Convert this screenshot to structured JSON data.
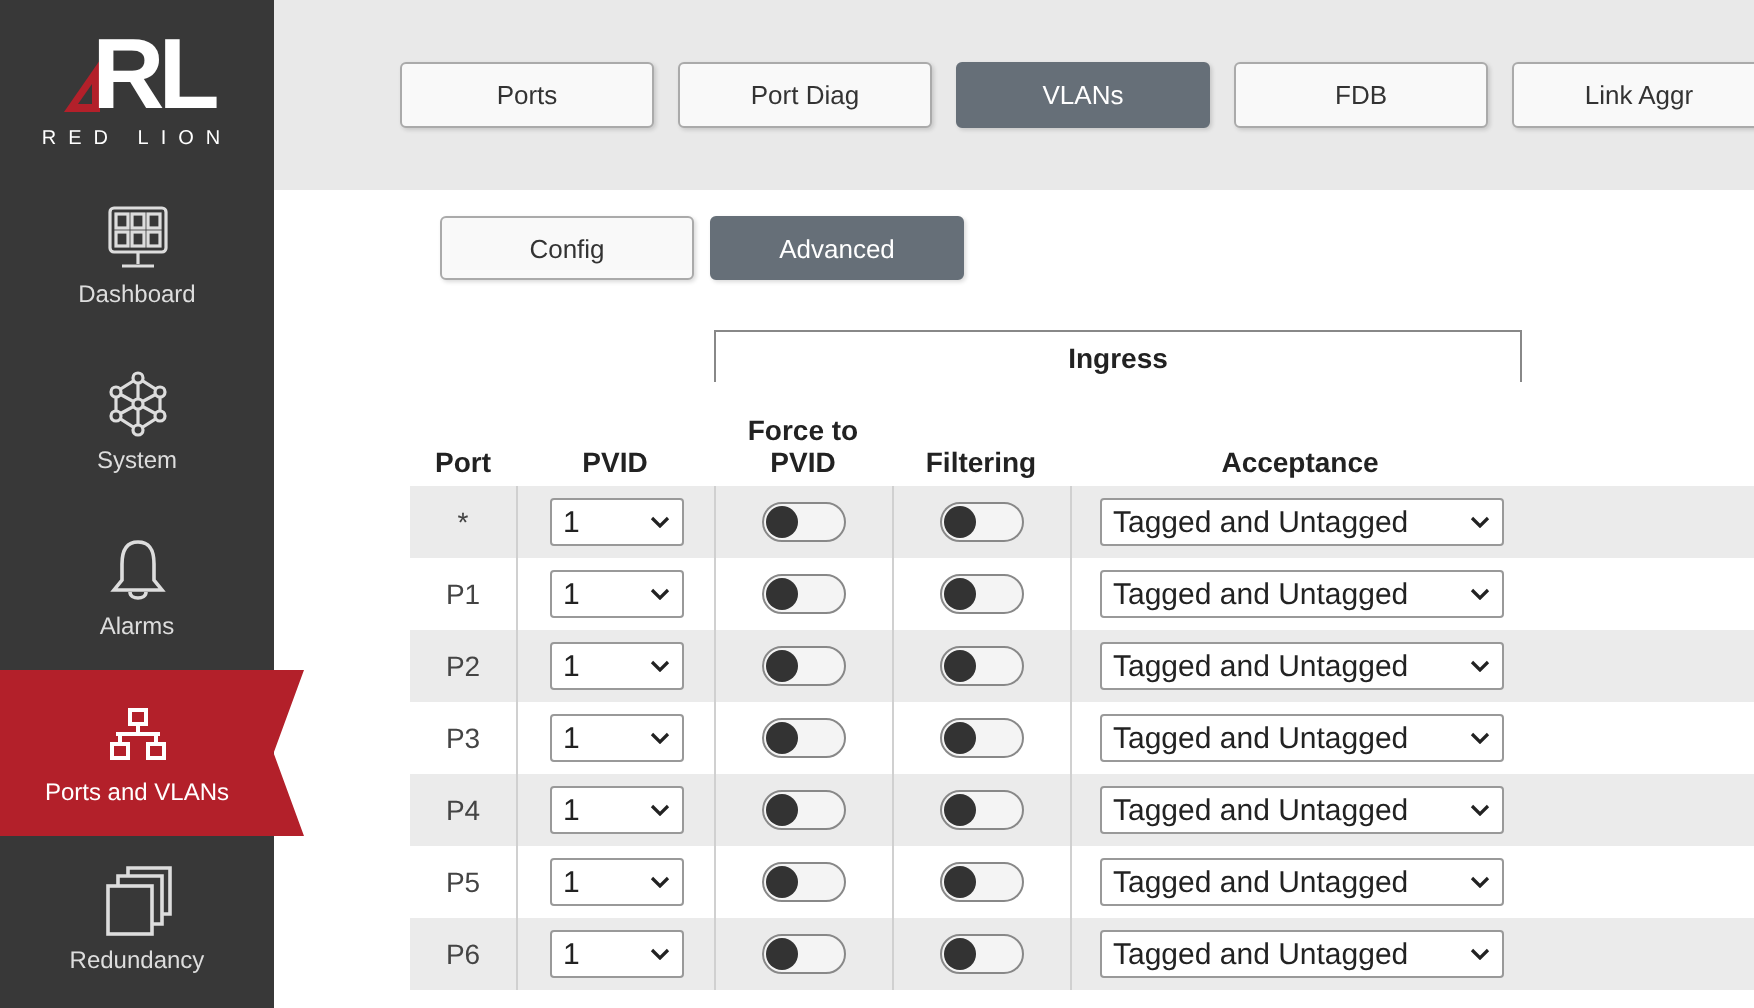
{
  "logo": {
    "mark": "RL",
    "wordmark": "RED LION"
  },
  "sidebar": {
    "items": [
      {
        "label": "Dashboard",
        "kind": "dashboard",
        "selected": false
      },
      {
        "label": "System",
        "kind": "system",
        "selected": false
      },
      {
        "label": "Alarms",
        "kind": "alarms",
        "selected": false
      },
      {
        "label": "Ports and VLANs",
        "kind": "network",
        "selected": true
      },
      {
        "label": "Redundancy",
        "kind": "redundancy",
        "selected": false
      }
    ]
  },
  "tabs": [
    {
      "label": "Ports",
      "selected": false
    },
    {
      "label": "Port Diag",
      "selected": false
    },
    {
      "label": "VLANs",
      "selected": true
    },
    {
      "label": "FDB",
      "selected": false
    },
    {
      "label": "Link Aggr",
      "selected": false
    }
  ],
  "subtabs": [
    {
      "label": "Config",
      "selected": false
    },
    {
      "label": "Advanced",
      "selected": true
    }
  ],
  "table": {
    "group_header": "Ingress",
    "columns": [
      "Port",
      "PVID",
      "Force to PVID",
      "Filtering",
      "Acceptance"
    ],
    "rows": [
      {
        "port": "*",
        "pvid": "1",
        "force_to_pvid": false,
        "filtering": false,
        "acceptance": "Tagged and Untagged"
      },
      {
        "port": "P1",
        "pvid": "1",
        "force_to_pvid": false,
        "filtering": false,
        "acceptance": "Tagged and Untagged"
      },
      {
        "port": "P2",
        "pvid": "1",
        "force_to_pvid": false,
        "filtering": false,
        "acceptance": "Tagged and Untagged"
      },
      {
        "port": "P3",
        "pvid": "1",
        "force_to_pvid": false,
        "filtering": false,
        "acceptance": "Tagged and Untagged"
      },
      {
        "port": "P4",
        "pvid": "1",
        "force_to_pvid": false,
        "filtering": false,
        "acceptance": "Tagged and Untagged"
      },
      {
        "port": "P5",
        "pvid": "1",
        "force_to_pvid": false,
        "filtering": false,
        "acceptance": "Tagged and Untagged"
      },
      {
        "port": "P6",
        "pvid": "1",
        "force_to_pvid": false,
        "filtering": false,
        "acceptance": "Tagged and Untagged"
      }
    ]
  }
}
